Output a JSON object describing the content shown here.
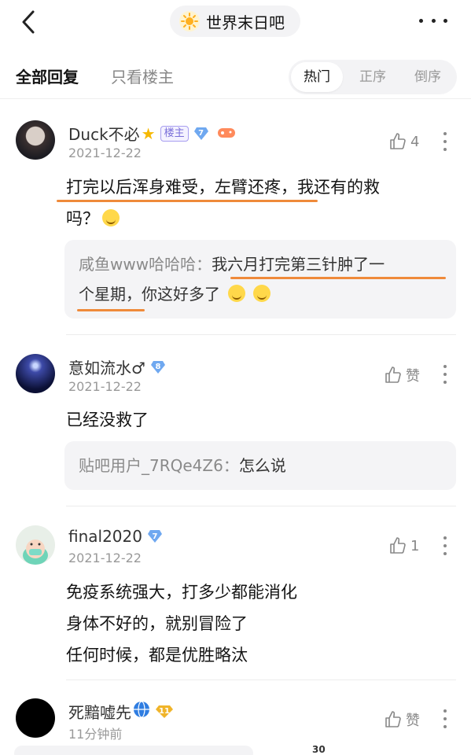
{
  "header": {
    "forum_name": "世界末日吧",
    "icons": [
      "back-chevron",
      "sun-forum-icon",
      "more-dots"
    ]
  },
  "filter": {
    "tab_all": "全部回复",
    "tab_owner": "只看楼主",
    "sort_hot": "热门",
    "sort_asc": "正序",
    "sort_desc": "倒序"
  },
  "comments": [
    {
      "user": "Duck不必",
      "badge": "楼主",
      "level": "7",
      "date": "2021-12-22",
      "likes": "4",
      "text_line1": "打完以后浑身难受，左臂还疼，我还有的救",
      "text_line2": "吗？",
      "reply_author": "咸鱼www哈哈哈：",
      "reply_line1": "我六月打完第三针肿了一",
      "reply_line2": "个星期，你这好多了"
    },
    {
      "user": "意如流水♂",
      "level": "8",
      "date": "2021-12-22",
      "likes": "赞",
      "text": "已经没救了",
      "reply_author": "贴吧用户_7RQe4Z6：",
      "reply_text": "怎么说"
    },
    {
      "user": "final2020",
      "level": "7",
      "date": "2021-12-22",
      "likes": "1",
      "lines": [
        "免疫系统强大，打多少都能消化",
        "身体不好的，就别冒险了",
        "任何时候，都是优胜略汰"
      ]
    },
    {
      "user": "死黯嘘先",
      "level": "11",
      "date": "11分钟前",
      "likes": "赞"
    }
  ],
  "bottom": {
    "count": "30"
  },
  "colors": {
    "underline": "#ef8a3a",
    "level_badge": "#6fa8f0",
    "owner_badge": "#7a6fd9"
  }
}
